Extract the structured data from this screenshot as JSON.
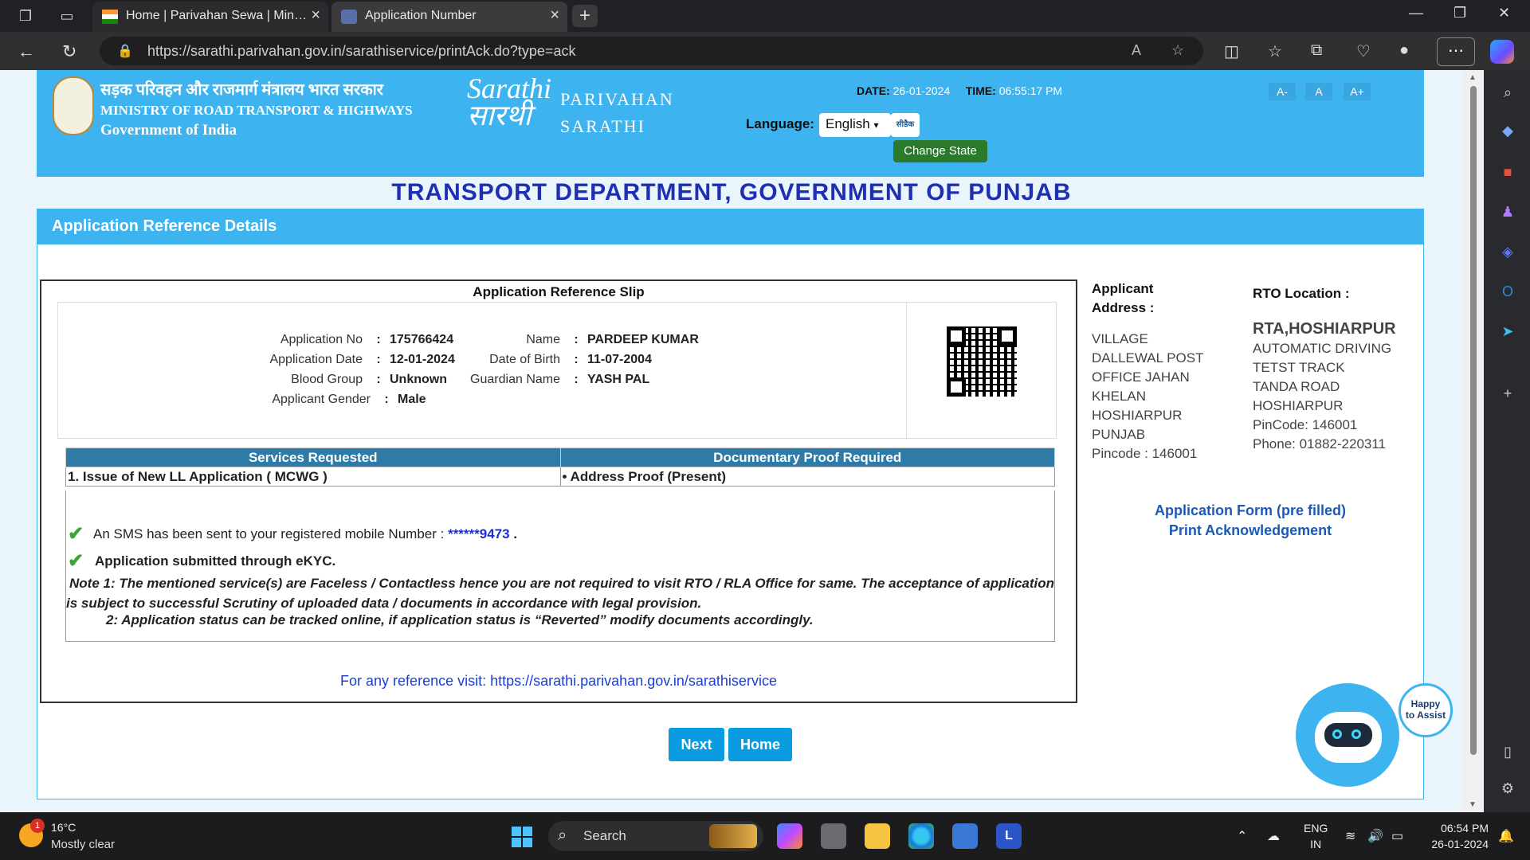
{
  "browser": {
    "tabs": [
      {
        "label": "Home | Parivahan Sewa | Ministry of Road Transport & Highways"
      },
      {
        "label": "Application Number"
      }
    ],
    "url": "https://sarathi.parivahan.gov.in/sarathiservice/printAck.do?type=ack"
  },
  "header": {
    "ministry_hindi": "सड़क परिवहन और राजमार्ग मंत्रालय भारत सरकार",
    "ministry_english": "MINISTRY OF ROAD TRANSPORT & HIGHWAYS",
    "government": "Government of India",
    "logo_latin": "Sarathi",
    "logo_devanagari": "सारथी",
    "parivahan": "PARIVAHAN",
    "sarathi": "SARATHI",
    "date_label": "DATE:",
    "date_value": "26-01-2024",
    "time_label": "TIME:",
    "time_value": "06:55:17 PM",
    "language_label": "Language:",
    "language_value": "English",
    "cdac": "सीडैक CDAC",
    "change_state": "Change State",
    "font_small": "A-",
    "font_normal": "A",
    "font_large": "A+"
  },
  "department_title": "TRANSPORT DEPARTMENT, GOVERNMENT OF PUNJAB",
  "panel_title": "Application Reference Details",
  "slip": {
    "title": "Application Reference Slip",
    "application_no_label": "Application No",
    "application_no": "175766424",
    "application_date_label": "Application Date",
    "application_date": "12-01-2024",
    "blood_group_label": "Blood Group",
    "blood_group": "Unknown",
    "gender_label": "Applicant Gender",
    "gender": "Male",
    "name_label": "Name",
    "name": "PARDEEP KUMAR",
    "dob_label": "Date of Birth",
    "dob": "11-07-2004",
    "guardian_label": "Guardian Name",
    "guardian": "YASH PAL",
    "colon": ":",
    "services_header": "Services Requested",
    "proof_header": "Documentary Proof Required",
    "service_1": "1. Issue of New LL Application ( MCWG )",
    "proof_1": "• Address Proof (Present)",
    "sms_text": "An SMS has been sent to your registered mobile Number :",
    "mobile_masked": "******9473",
    "sms_end": ".",
    "ekyc_text": "Application submitted through eKYC.",
    "note_1": "Note 1:  The mentioned service(s) are Faceless / Contactless hence you are not required to visit RTO / RLA Office for same. The acceptance of application is subject to successful Scrutiny of uploaded data / documents in accordance with legal provision.",
    "note_2": "2:  Application status can be tracked online, if application status is “Reverted” modify documents accordingly.",
    "reference": "For any reference visit: https://sarathi.parivahan.gov.in/sarathiservice"
  },
  "applicant_address": {
    "label_line1": "Applicant",
    "label_line2": "Address :",
    "lines": [
      "VILLAGE",
      "DALLEWAL POST",
      "OFFICE JAHAN",
      "KHELAN",
      "HOSHIARPUR",
      "PUNJAB",
      "Pincode : 146001"
    ]
  },
  "rto": {
    "label": "RTO Location :",
    "name": "RTA,HOSHIARPUR",
    "lines": [
      "AUTOMATIC DRIVING",
      "TETST TRACK",
      "TANDA ROAD",
      "HOSHIARPUR",
      "PinCode:  146001",
      "Phone:  01882-220311"
    ]
  },
  "links": {
    "application_form": "Application Form (pre filled)",
    "print_ack": "Print Acknowledgement"
  },
  "buttons": {
    "next": "Next",
    "home": "Home"
  },
  "assist": {
    "line1": "Happy",
    "line2": "to Assist"
  },
  "taskbar": {
    "weather_badge": "1",
    "temperature": "16°C",
    "condition": "Mostly clear",
    "search": "Search",
    "lang": "ENG",
    "region": "IN",
    "time": "06:54 PM",
    "date": "26-01-2024",
    "launcher_letter": "L"
  },
  "colors": {
    "header_blue": "#3db3ef",
    "dept_title": "#1f2fb3",
    "table_header": "#2d7ba6",
    "button": "#0a9be0",
    "change_state": "#2b7a2b"
  }
}
